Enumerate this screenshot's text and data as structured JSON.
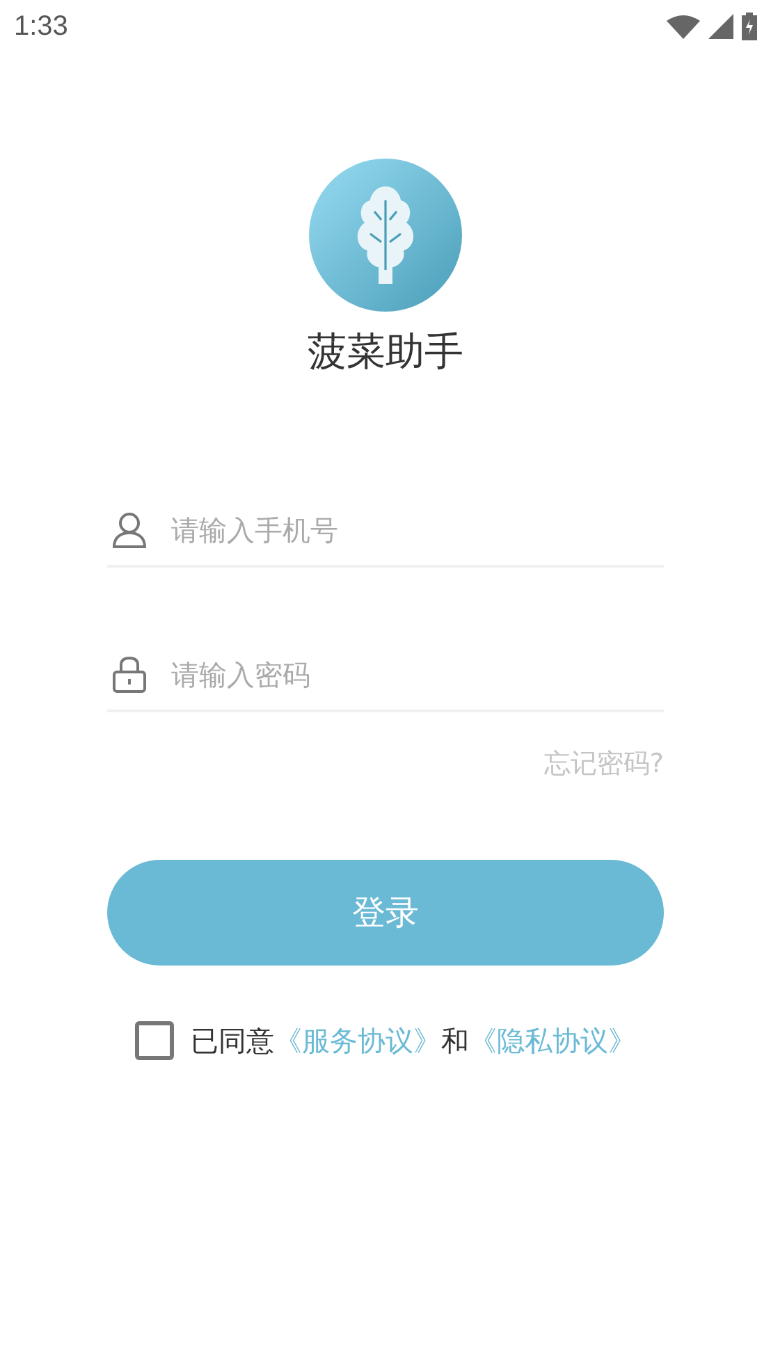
{
  "status_bar": {
    "time": "1:33"
  },
  "app": {
    "name": "菠菜助手"
  },
  "phone_field": {
    "placeholder": "请输入手机号"
  },
  "password_field": {
    "placeholder": "请输入密码"
  },
  "forgot_link": "忘记密码?",
  "login_button": "登录",
  "agreement": {
    "checked": false,
    "prefix": "已同意",
    "service_link": "《服务协议》",
    "joiner": "和",
    "privacy_link": "《隐私协议》"
  }
}
